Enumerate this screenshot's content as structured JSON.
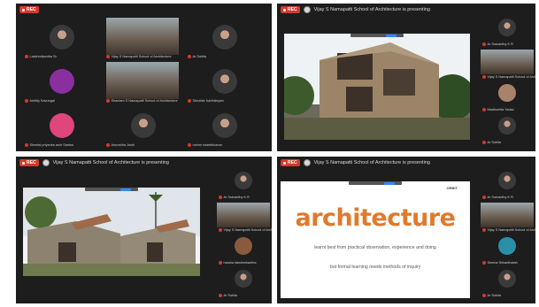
{
  "q1": {
    "rec": "REC",
    "tiles": [
      {
        "name": "Lakshmikantha Sr",
        "avatar": "photo"
      },
      {
        "name": "Vijay S Namapatti School of Architecture",
        "avatar": "video"
      },
      {
        "name": "Ar Suhila",
        "avatar": "photo"
      },
      {
        "name": "Ambily Kavungal",
        "avatar": "letter",
        "letter": "A",
        "color": "#8a2fa0"
      },
      {
        "name": "Shantam S Namapatti School of Architecture",
        "avatar": "video"
      },
      {
        "name": "Shruthie Karthikeyan",
        "avatar": "photo"
      },
      {
        "name": "Sheetal priyanka arch Santos",
        "avatar": "letter",
        "letter": "S",
        "color": "#e0457b"
      },
      {
        "name": "Anuradha Joshi",
        "avatar": "photo"
      },
      {
        "name": "roshni shanthkumar",
        "avatar": "photo"
      }
    ]
  },
  "q2": {
    "rec": "REC",
    "title": "Vijay S Namapatti School of Architecture is presenting",
    "side": [
      {
        "name": "Ar Sravanthy K R",
        "avatar": "photo"
      },
      {
        "name": "Vijay S Namapatti School of Architecture",
        "avatar": "video"
      },
      {
        "name": "Madhumita Yadav",
        "avatar": "letter",
        "letter": "M",
        "color": "#a8826a"
      },
      {
        "name": "Ar Suhila",
        "avatar": "photo"
      }
    ]
  },
  "q3": {
    "rec": "REC",
    "title": "Vijay S Namapatti School of Architecture is presenting",
    "side": [
      {
        "name": "Ar Sravanthy K R",
        "avatar": "photo"
      },
      {
        "name": "Vijay S Namapatti School of Architecture",
        "avatar": "video"
      },
      {
        "name": "harsha lakshmikantha",
        "avatar": "letter",
        "letter": "h",
        "color": "#8a5a3c"
      },
      {
        "name": "Ar Suhila",
        "avatar": "photo"
      }
    ]
  },
  "q4": {
    "rec": "REC",
    "title": "Vijay S Namapatti School of Architecture is presenting",
    "slide_heading": "architecture",
    "slide_line1": "learnt best from practical observation, experience and doing",
    "slide_line2": "but formal learning needs methods of inquiry",
    "slide_logo": "ORBIT",
    "side": [
      {
        "name": "Ar Sravanthy K R",
        "avatar": "photo"
      },
      {
        "name": "Vijay S Namapatti School of Architecture",
        "avatar": "video"
      },
      {
        "name": "Seema Srikanthaiah",
        "avatar": "letter",
        "letter": "S",
        "color": "#2a8fa8"
      },
      {
        "name": "Ar Suhila",
        "avatar": "photo"
      }
    ]
  }
}
